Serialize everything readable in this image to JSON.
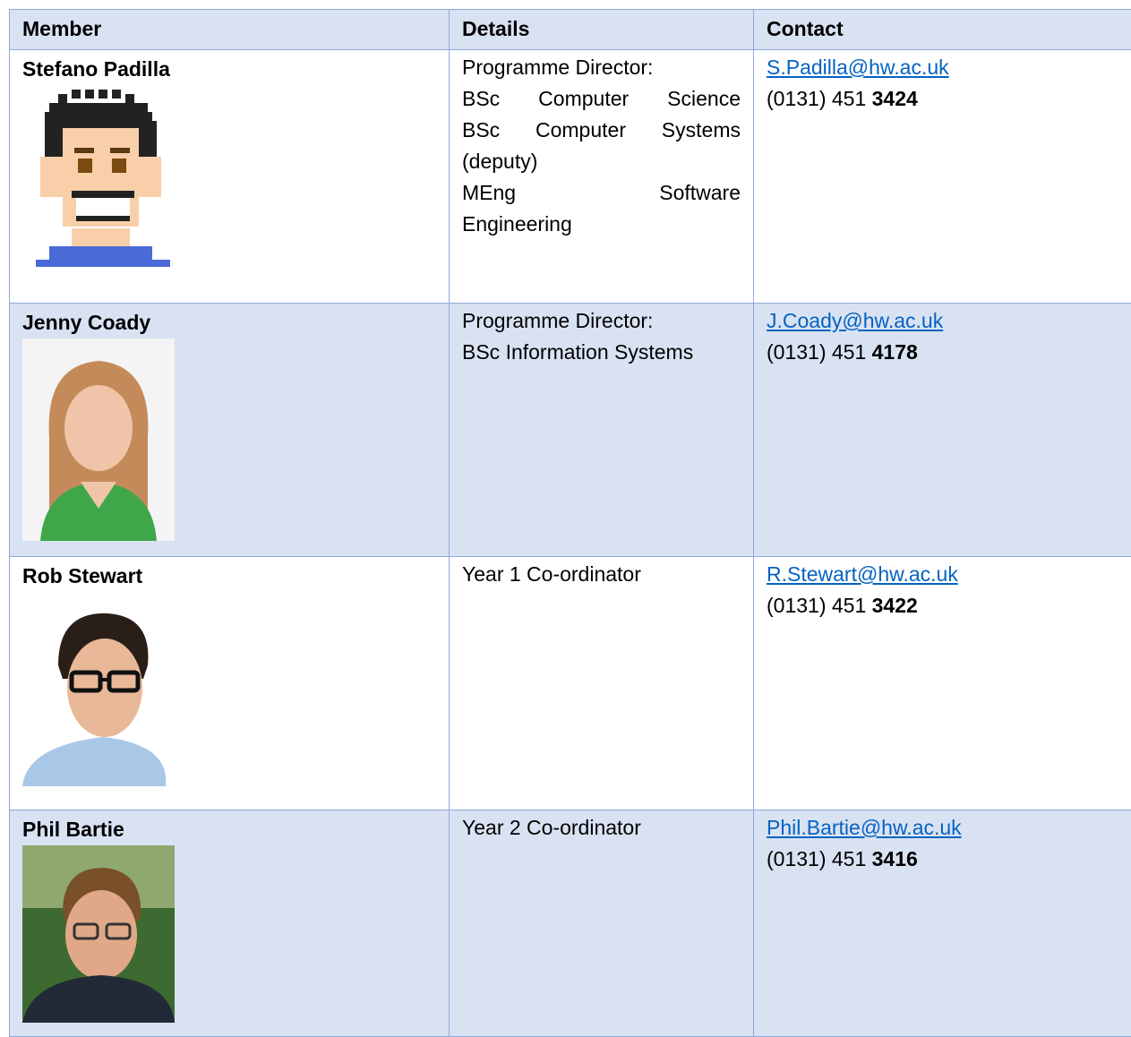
{
  "headers": {
    "member": "Member",
    "details": "Details",
    "contact": "Contact"
  },
  "rows": [
    {
      "name": "Stefano Padilla",
      "photo_icon": "pixel-avatar-icon",
      "details": [
        "Programme Director:",
        "BSc Computer Science",
        "BSc Computer Systems",
        "(deputy)",
        "MEng Software",
        "Engineering"
      ],
      "email": "S.Padilla@hw.ac.uk",
      "phone_prefix": "(0131) 451 ",
      "phone_ext": "3424"
    },
    {
      "name": "Jenny Coady",
      "photo_icon": "person-photo-icon",
      "details": [
        "Programme Director:",
        "BSc Information Systems"
      ],
      "email": "J.Coady@hw.ac.uk",
      "phone_prefix": "(0131) 451 ",
      "phone_ext": "4178"
    },
    {
      "name": "Rob Stewart",
      "photo_icon": "person-photo-icon",
      "details": [
        "Year 1 Co-ordinator"
      ],
      "email": "R.Stewart@hw.ac.uk",
      "phone_prefix": "(0131) 451 ",
      "phone_ext": "3422"
    },
    {
      "name": "Phil Bartie",
      "photo_icon": "person-photo-icon",
      "details": [
        "Year 2 Co-ordinator"
      ],
      "email": "Phil.Bartie@hw.ac.uk",
      "phone_prefix": "(0131) 451 ",
      "phone_ext": "3416"
    }
  ],
  "colors": {
    "header_bg": "#d9e2f3",
    "border": "#8eaadb",
    "link": "#0563c1"
  }
}
